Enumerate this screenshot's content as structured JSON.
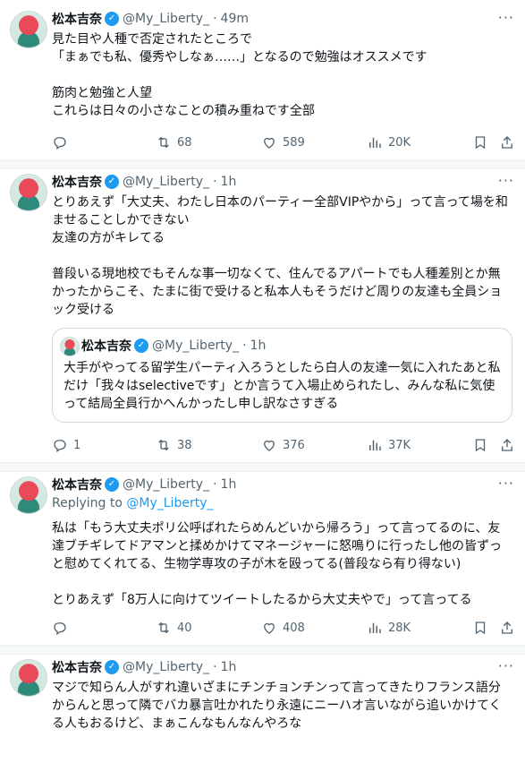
{
  "tweets": [
    {
      "author": "松本吉奈",
      "handle": "@My_Liberty_",
      "time": "49m",
      "body": "見た目や人種で否定されたところで\n「まぁでも私、優秀やしなぁ……」となるので勉強はオススメです\n\n筋肉と勉強と人望\nこれらは日々の小さなことの積み重ねです全部",
      "replies": "",
      "retweets": "68",
      "likes": "589",
      "views": "20K"
    },
    {
      "author": "松本吉奈",
      "handle": "@My_Liberty_",
      "time": "1h",
      "body": "とりあえず「大丈夫、わたし日本のパーティー全部VIPやから」って言って場を和ませることしかできない\n友達の方がキレてる\n\n普段いる現地校でもそんな事一切なくて、住んでるアパートでも人種差別とか無かったからこそ、たまに街で受けると私本人もそうだけど周りの友達も全員ショック受ける",
      "quote": {
        "author": "松本吉奈",
        "handle": "@My_Liberty_",
        "time": "1h",
        "body": "大手がやってる留学生パーティ入ろうとしたら白人の友達一気に入れたあと私だけ「我々はselectiveです」とか言うて入場止められたし、みんな私に気使って結局全員行かへんかったし申し訳なさすぎる"
      },
      "replies": "1",
      "retweets": "38",
      "likes": "376",
      "views": "37K"
    },
    {
      "author": "松本吉奈",
      "handle": "@My_Liberty_",
      "time": "1h",
      "replying_label": "Replying to",
      "replying_to": "@My_Liberty_",
      "body": "私は「もう大丈夫ポリ公呼ばれたらめんどいから帰ろう」って言ってるのに、友達ブチギレてドアマンと揉めかけてマネージャーに怒鳴りに行ったし他の皆ずっと慰めてくれてる、生物学専攻の子が木を殴ってる(普段なら有り得ない)\n\nとりあえず「8万人に向けてツイートしたるから大丈夫やで」って言ってる",
      "replies": "",
      "retweets": "40",
      "likes": "408",
      "views": "28K"
    },
    {
      "author": "松本吉奈",
      "handle": "@My_Liberty_",
      "time": "1h",
      "body": "マジで知らん人がすれ違いざまにチンチョンチンって言ってきたりフランス語分からんと思って隣でバカ暴言吐かれたり永遠にニーハオ言いながら追いかけてくる人もおるけど、まぁこんなもんなんやろな"
    }
  ],
  "icons": {
    "verified": "verified-badge",
    "reply": "reply-icon",
    "retweet": "retweet-icon",
    "like": "heart-icon",
    "views": "views-icon",
    "bookmark": "bookmark-icon",
    "share": "share-icon",
    "more": "more-icon"
  },
  "colors": {
    "accent": "#1d9bf0",
    "muted": "#536471",
    "text": "#0f1419"
  }
}
